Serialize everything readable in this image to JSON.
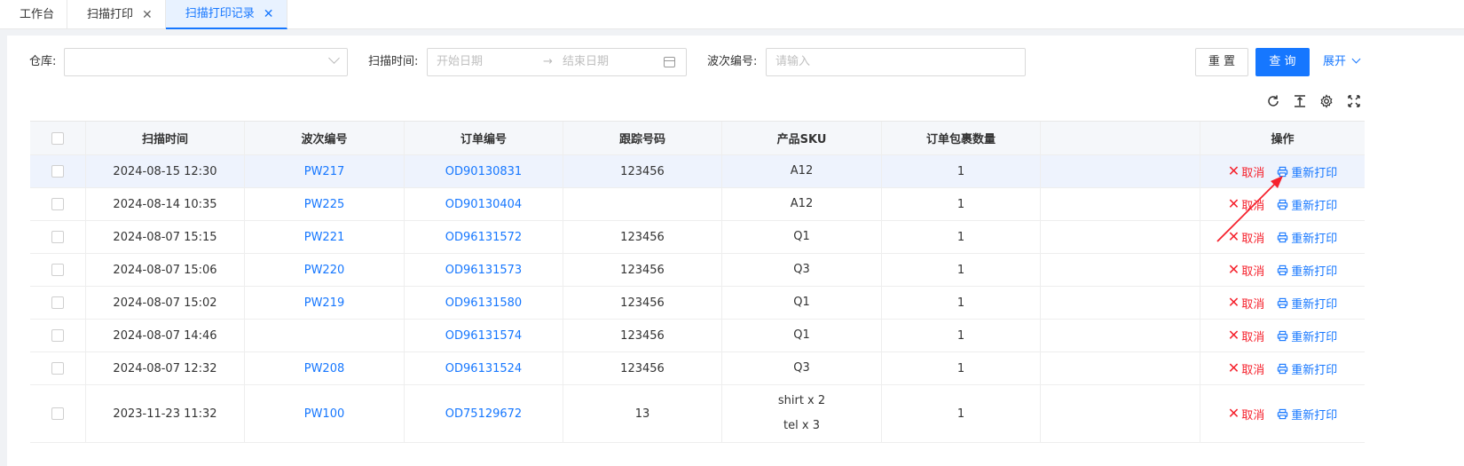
{
  "tabs": [
    {
      "label": "工作台",
      "closable": false,
      "active": false
    },
    {
      "label": "扫描打印",
      "closable": true,
      "active": false
    },
    {
      "label": "扫描打印记录",
      "closable": true,
      "active": true
    }
  ],
  "filters": {
    "warehouse_label": "仓库:",
    "warehouse_value": "",
    "scan_time_label": "扫描时间:",
    "start_placeholder": "开始日期",
    "end_placeholder": "结束日期",
    "range_separator": "→",
    "wave_label": "波次编号:",
    "wave_placeholder": "请输入",
    "reset_label": "重 置",
    "query_label": "查 询",
    "expand_label": "展开"
  },
  "colors": {
    "accent": "#1677ff",
    "danger": "#f5222d",
    "header_bg": "#f5f7fa",
    "selected_row_bg": "#eef3fd"
  },
  "toolbar_icons": [
    "refresh-icon",
    "column-height-icon",
    "settings-icon",
    "fullscreen-icon"
  ],
  "table": {
    "columns": [
      "",
      "扫描时间",
      "波次编号",
      "订单编号",
      "跟踪号码",
      "产品SKU",
      "订单包裹数量",
      "",
      "操作"
    ],
    "cancel_label": "取消",
    "reprint_label": "重新打印",
    "rows": [
      {
        "scan_time": "2024-08-15 12:30",
        "wave": "PW217",
        "order": "OD90130831",
        "tracking": "123456",
        "sku": [
          "A12"
        ],
        "qty": "1",
        "selected": true
      },
      {
        "scan_time": "2024-08-14 10:35",
        "wave": "PW225",
        "order": "OD90130404",
        "tracking": "",
        "sku": [
          "A12"
        ],
        "qty": "1",
        "selected": false
      },
      {
        "scan_time": "2024-08-07 15:15",
        "wave": "PW221",
        "order": "OD96131572",
        "tracking": "123456",
        "sku": [
          "Q1"
        ],
        "qty": "1",
        "selected": false
      },
      {
        "scan_time": "2024-08-07 15:06",
        "wave": "PW220",
        "order": "OD96131573",
        "tracking": "123456",
        "sku": [
          "Q3"
        ],
        "qty": "1",
        "selected": false
      },
      {
        "scan_time": "2024-08-07 15:02",
        "wave": "PW219",
        "order": "OD96131580",
        "tracking": "123456",
        "sku": [
          "Q1"
        ],
        "qty": "1",
        "selected": false
      },
      {
        "scan_time": "2024-08-07 14:46",
        "wave": "",
        "order": "OD96131574",
        "tracking": "123456",
        "sku": [
          "Q1"
        ],
        "qty": "1",
        "selected": false
      },
      {
        "scan_time": "2024-08-07 12:32",
        "wave": "PW208",
        "order": "OD96131524",
        "tracking": "123456",
        "sku": [
          "Q3"
        ],
        "qty": "1",
        "selected": false
      },
      {
        "scan_time": "2023-11-23 11:32",
        "wave": "PW100",
        "order": "OD75129672",
        "tracking": "13",
        "sku": [
          "shirt x 2",
          "tel x 3"
        ],
        "qty": "1",
        "selected": false
      }
    ]
  }
}
